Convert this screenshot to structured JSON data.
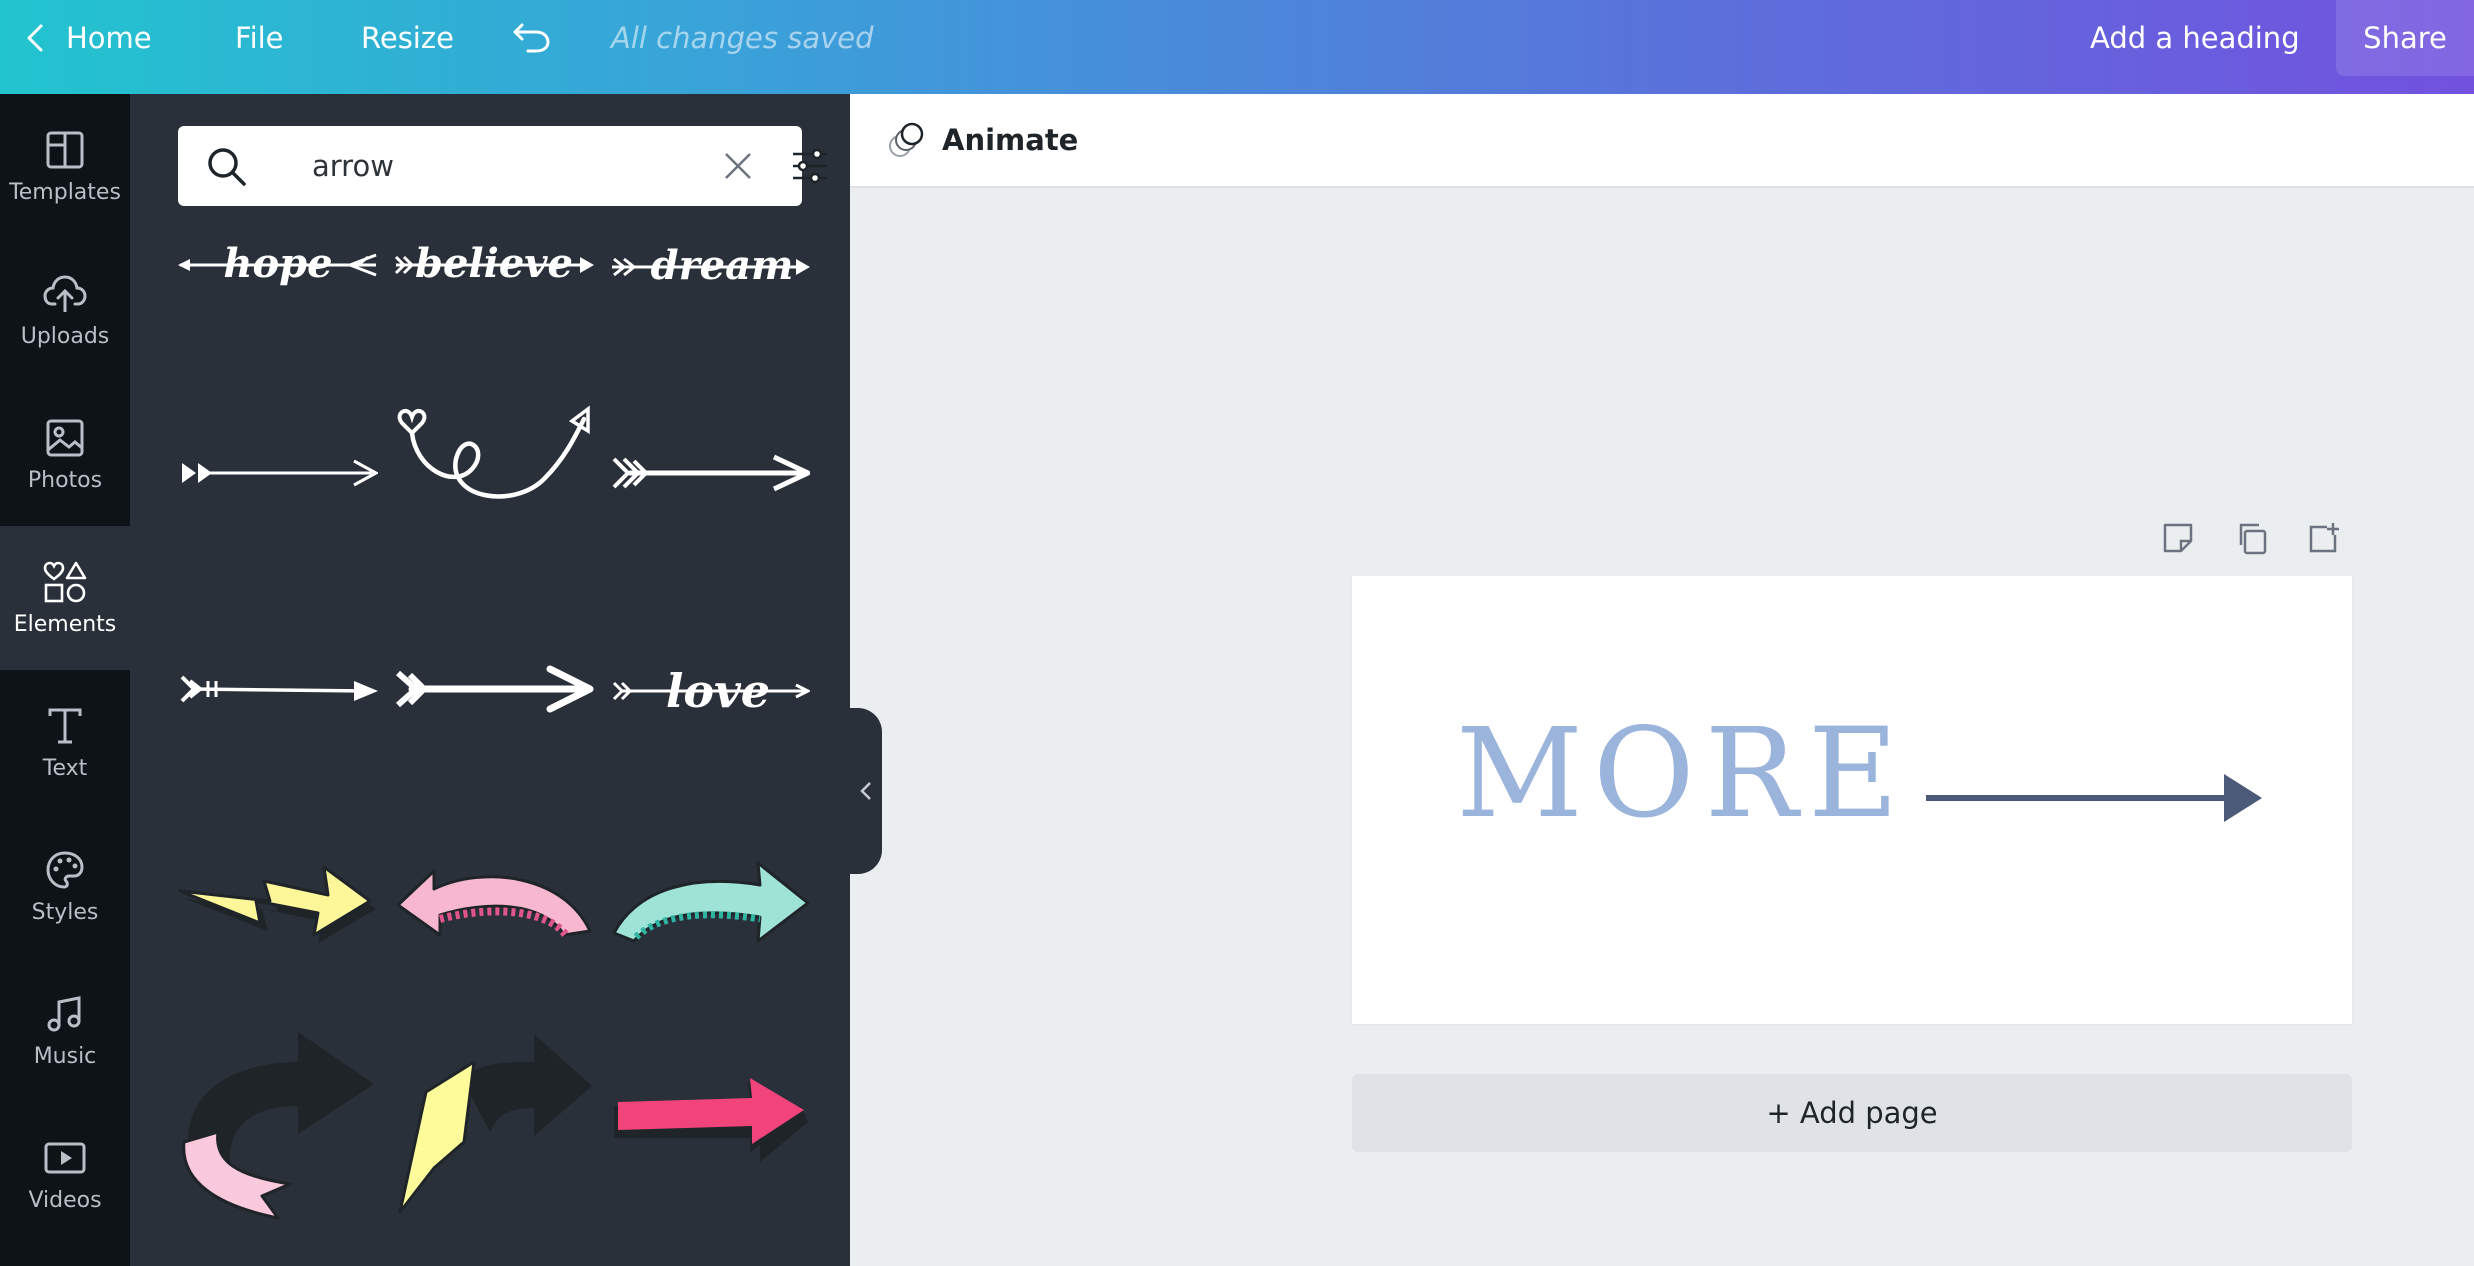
{
  "topbar": {
    "home_label": "Home",
    "file_label": "File",
    "resize_label": "Resize",
    "saved_status": "All changes saved",
    "heading_label": "Add a heading",
    "share_label": "Share"
  },
  "rail": {
    "items": [
      {
        "label": "Templates",
        "icon": "templates-icon"
      },
      {
        "label": "Uploads",
        "icon": "upload-cloud-icon"
      },
      {
        "label": "Photos",
        "icon": "photo-icon"
      },
      {
        "label": "Elements",
        "icon": "shapes-icon",
        "active": true
      },
      {
        "label": "Text",
        "icon": "text-icon"
      },
      {
        "label": "Styles",
        "icon": "palette-icon"
      },
      {
        "label": "Music",
        "icon": "music-note-icon"
      },
      {
        "label": "Videos",
        "icon": "video-icon"
      }
    ]
  },
  "panel": {
    "search_value": "arrow",
    "results": [
      "hope-arrow",
      "believe-arrow",
      "dream-arrow",
      "simple-arrow",
      "loop-arrow",
      "feather-arrow",
      "thin-arrow",
      "bold-arrow",
      "love-arrow",
      "yellow-zigzag-arrow",
      "pink-curved-arrow",
      "teal-curved-arrow",
      "black-pink-curl-arrow",
      "black-yellow-ribbon-arrow",
      "pink-block-arrow"
    ]
  },
  "toolbar": {
    "animate_label": "Animate"
  },
  "canvas": {
    "page_text": "MORE",
    "add_page_label": "+ Add page",
    "colors": {
      "text": "#9bb4dc",
      "arrow": "#4a5a78"
    }
  },
  "colors": {
    "topbar_start": "#22c4cf",
    "topbar_end": "#7252df",
    "panel_bg": "#293039",
    "rail_bg": "#0e1318"
  }
}
